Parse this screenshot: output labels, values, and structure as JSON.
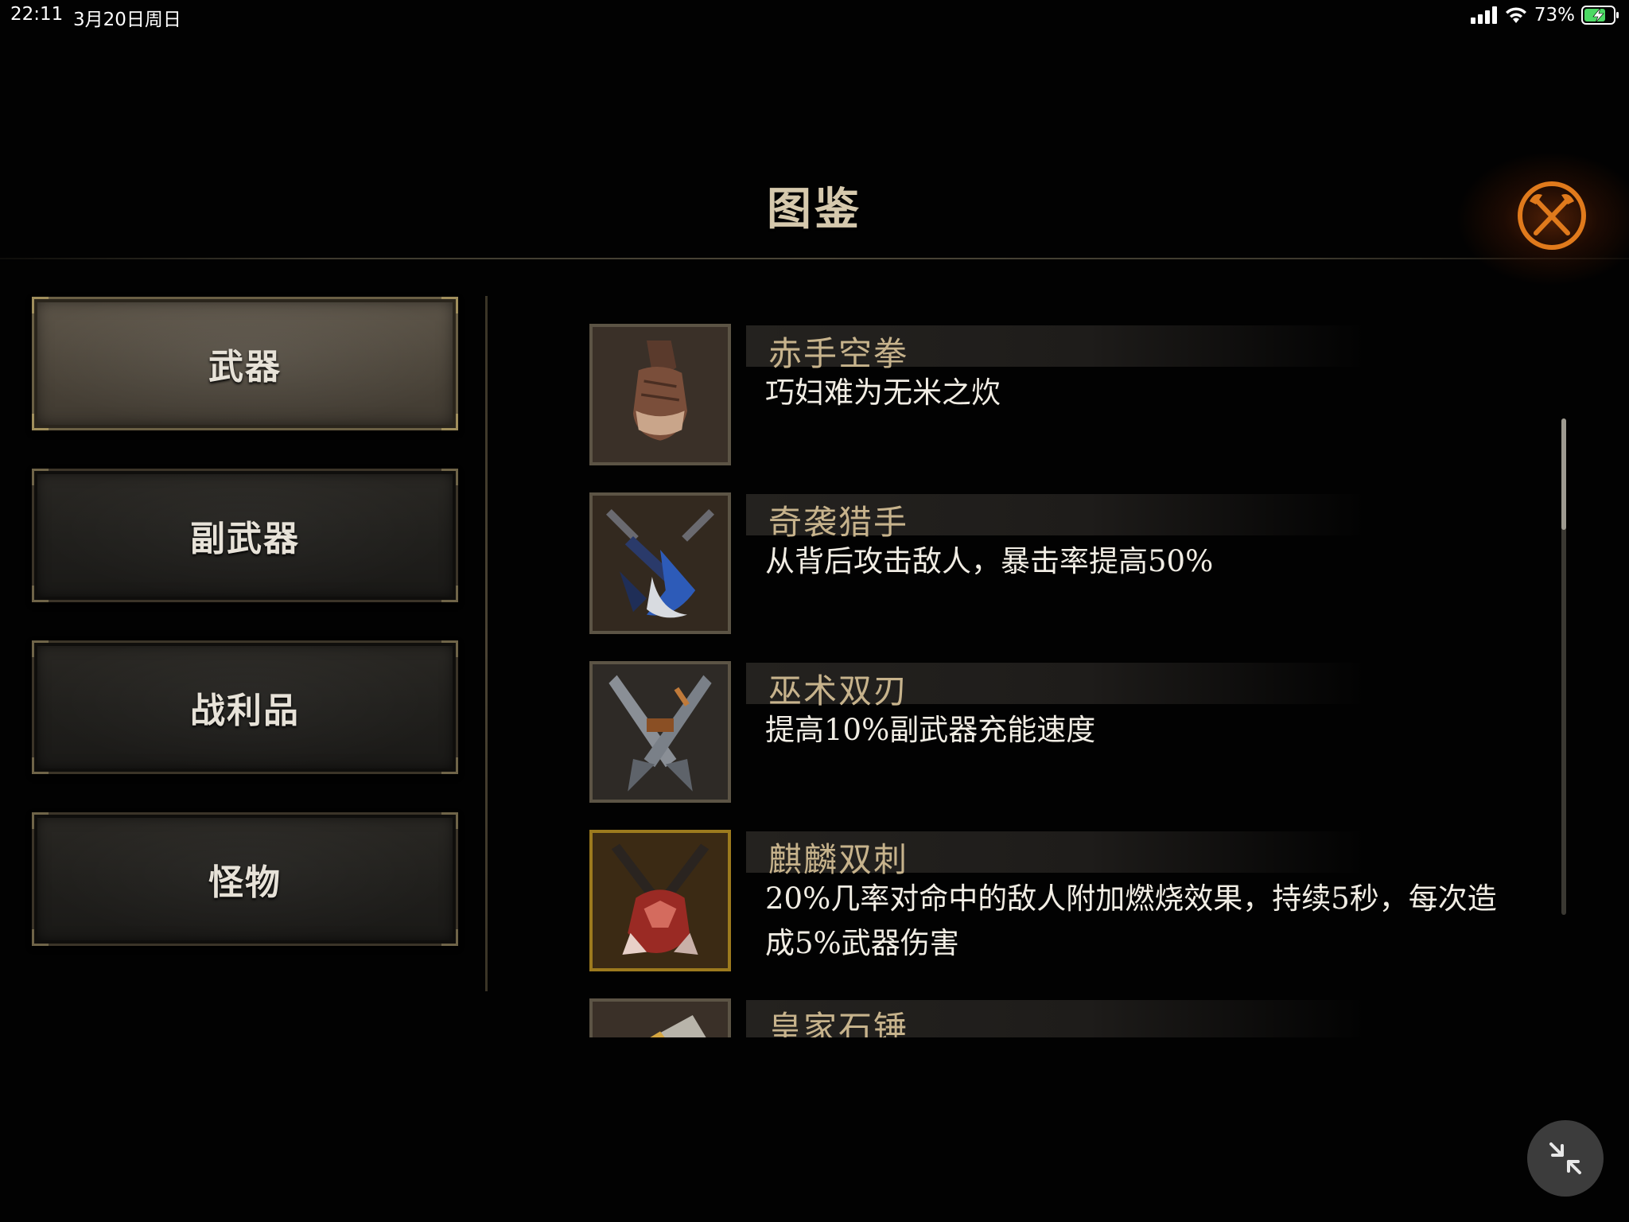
{
  "status_bar": {
    "time": "22:11",
    "date": "3月20日周日",
    "battery": "73%",
    "icons": [
      "cellular-signal-icon",
      "wifi-icon",
      "battery-charging-icon"
    ]
  },
  "header": {
    "title": "图鉴",
    "close_icon": "crossed-axes-close-icon"
  },
  "tabs": [
    {
      "label": "武器",
      "active": true
    },
    {
      "label": "副武器",
      "active": false
    },
    {
      "label": "战利品",
      "active": false
    },
    {
      "label": "怪物",
      "active": false
    }
  ],
  "items": [
    {
      "name": "赤手空拳",
      "desc": "巧妇难为无米之炊",
      "icon": "fist-icon"
    },
    {
      "name": "奇袭猎手",
      "desc": "从背后攻击敌人，暴击率提高50%",
      "icon": "hunter-blades-icon"
    },
    {
      "name": "巫术双刃",
      "desc": "提高10%副武器充能速度",
      "icon": "twin-blades-icon"
    },
    {
      "name": "麒麟双刺",
      "desc": "20%几率对命中的敌人附加燃烧效果，持续5秒，每次造成5%武器伤害",
      "icon": "qilin-daggers-icon"
    },
    {
      "name": "皇家石锤",
      "desc": "",
      "icon": "stone-hammer-icon"
    }
  ],
  "colors": {
    "background": "#020202",
    "title": "#d6c9ad",
    "item_name": "#c7b38c",
    "item_desc": "#f1ede4",
    "close_accent": "#e07a1c",
    "gold_frame": "#9c7a1e"
  },
  "controls": {
    "collapse_icon": "collapse-arrows-icon"
  }
}
